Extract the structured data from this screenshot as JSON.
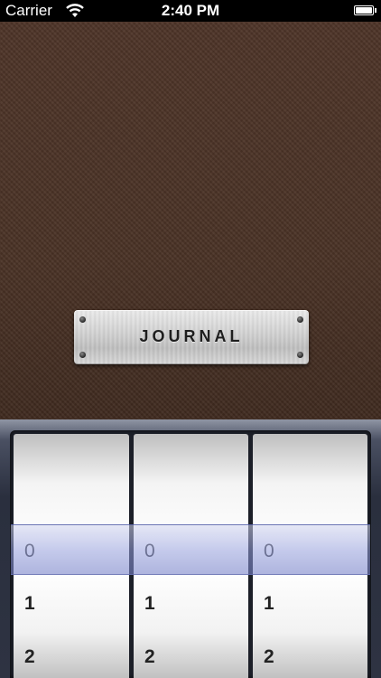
{
  "status_bar": {
    "carrier": "Carrier",
    "time": "2:40 PM"
  },
  "journal": {
    "title": "JOURNAL"
  },
  "picker": {
    "wheels": [
      {
        "selected": "0",
        "next": "1",
        "after": "2"
      },
      {
        "selected": "0",
        "next": "1",
        "after": "2"
      },
      {
        "selected": "0",
        "next": "1",
        "after": "2"
      }
    ]
  },
  "colors": {
    "leather": "#4b3326",
    "selection": "#9aa2dc"
  }
}
